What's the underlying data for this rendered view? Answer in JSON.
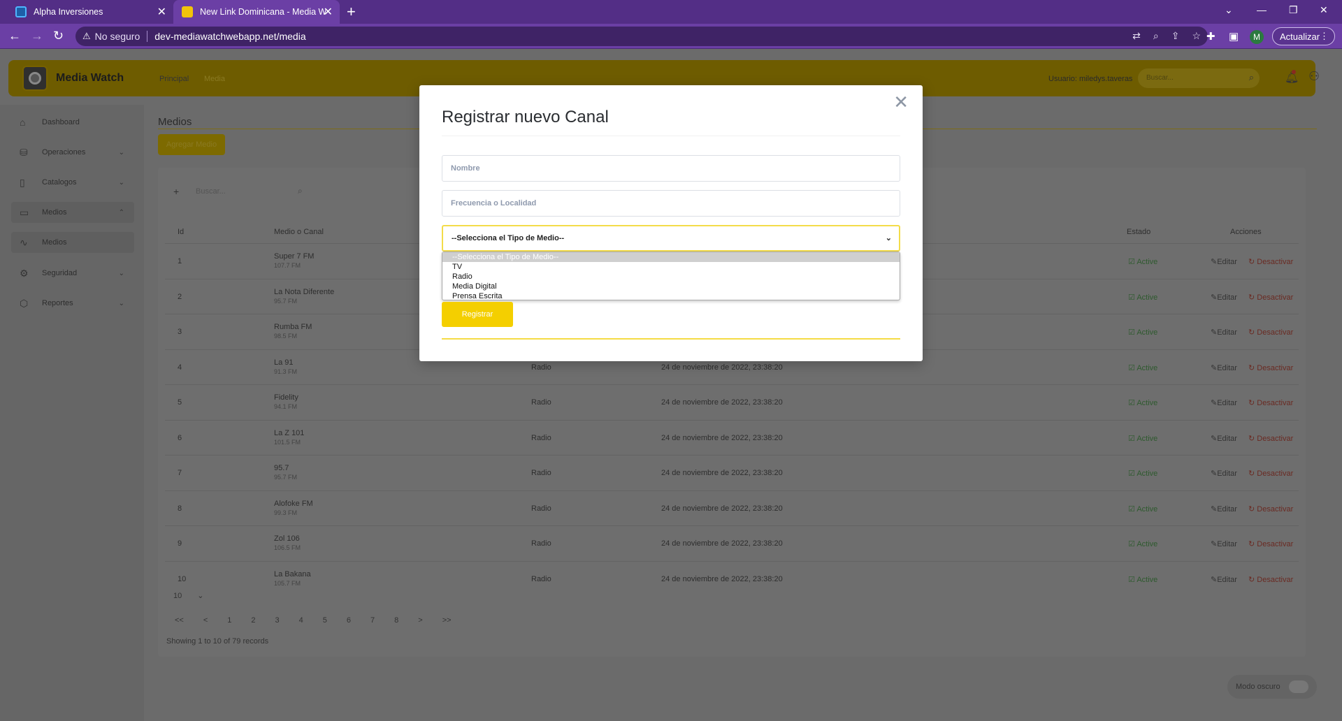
{
  "browser": {
    "tabs": [
      {
        "title": "Alpha Inversiones",
        "active": false
      },
      {
        "title": "New Link Dominicana - Media W",
        "active": true
      }
    ],
    "security_label": "No seguro",
    "url": "dev-mediawatchwebapp.net/media",
    "profile_initial": "M",
    "update_label": "Actualizar"
  },
  "app": {
    "brand": "Media Watch",
    "breadcrumb": [
      "Principal",
      "Media"
    ],
    "user_label": "Usuario: miledys.taveras",
    "search_placeholder": "Buscar...",
    "sidebar": [
      {
        "label": "Dashboard",
        "icon": "home-icon"
      },
      {
        "label": "Operaciones",
        "icon": "database-icon"
      },
      {
        "label": "Catalogos",
        "icon": "file-icon"
      },
      {
        "label": "Medios",
        "icon": "tv-icon"
      },
      {
        "label": "Medios",
        "icon": "activity-icon"
      },
      {
        "label": "Seguridad",
        "icon": "gear-icon"
      },
      {
        "label": "Reportes",
        "icon": "box-icon"
      }
    ],
    "page_title": "Medios",
    "add_button": "Agregar Medio",
    "table_search_placeholder": "Buscar...",
    "columns": [
      "Id",
      "Medio o Canal",
      "Estado",
      "Acciones"
    ],
    "rows": [
      {
        "id": "1",
        "name": "Super 7 FM",
        "freq": "107.7 FM",
        "type": "",
        "date": "",
        "status": "Active"
      },
      {
        "id": "2",
        "name": "La Nota Diferente",
        "freq": "95.7 FM",
        "type": "",
        "date": "",
        "status": "Active"
      },
      {
        "id": "3",
        "name": "Rumba FM",
        "freq": "98.5 FM",
        "type": "",
        "date": "",
        "status": "Active"
      },
      {
        "id": "4",
        "name": "La 91",
        "freq": "91.3 FM",
        "type": "Radio",
        "date": "24 de noviembre de 2022, 23:38:20",
        "status": "Active"
      },
      {
        "id": "5",
        "name": "Fidelity",
        "freq": "94.1 FM",
        "type": "Radio",
        "date": "24 de noviembre de 2022, 23:38:20",
        "status": "Active"
      },
      {
        "id": "6",
        "name": "La Z 101",
        "freq": "101.5 FM",
        "type": "Radio",
        "date": "24 de noviembre de 2022, 23:38:20",
        "status": "Active"
      },
      {
        "id": "7",
        "name": "95.7",
        "freq": "95.7 FM",
        "type": "Radio",
        "date": "24 de noviembre de 2022, 23:38:20",
        "status": "Active"
      },
      {
        "id": "8",
        "name": "Alofoke FM",
        "freq": "99.3 FM",
        "type": "Radio",
        "date": "24 de noviembre de 2022, 23:38:20",
        "status": "Active"
      },
      {
        "id": "9",
        "name": "Zol 106",
        "freq": "106.5 FM",
        "type": "Radio",
        "date": "24 de noviembre de 2022, 23:38:20",
        "status": "Active"
      },
      {
        "id": "10",
        "name": "La Bakana",
        "freq": "105.7 FM",
        "type": "Radio",
        "date": "24 de noviembre de 2022, 23:38:20",
        "status": "Active"
      }
    ],
    "edit_label": "Editar",
    "deactivate_label": "Desactivar",
    "page_size": "10",
    "pagination": [
      "<<",
      "<",
      "1",
      "2",
      "3",
      "4",
      "5",
      "6",
      "7",
      "8",
      ">",
      ">>"
    ],
    "showing": "Showing 1 to 10 of 79 records",
    "dark_mode": "Modo oscuro"
  },
  "modal": {
    "title": "Registrar nuevo Canal",
    "name_placeholder": "Nombre",
    "freq_placeholder": "Frecuencia o Localidad",
    "select_value": "--Selecciona el Tipo de Medio--",
    "options": [
      "--Selecciona el Tipo de Medio--",
      "TV",
      "Radio",
      "Media Digital",
      "Prensa Escrita"
    ],
    "submit": "Registrar"
  }
}
